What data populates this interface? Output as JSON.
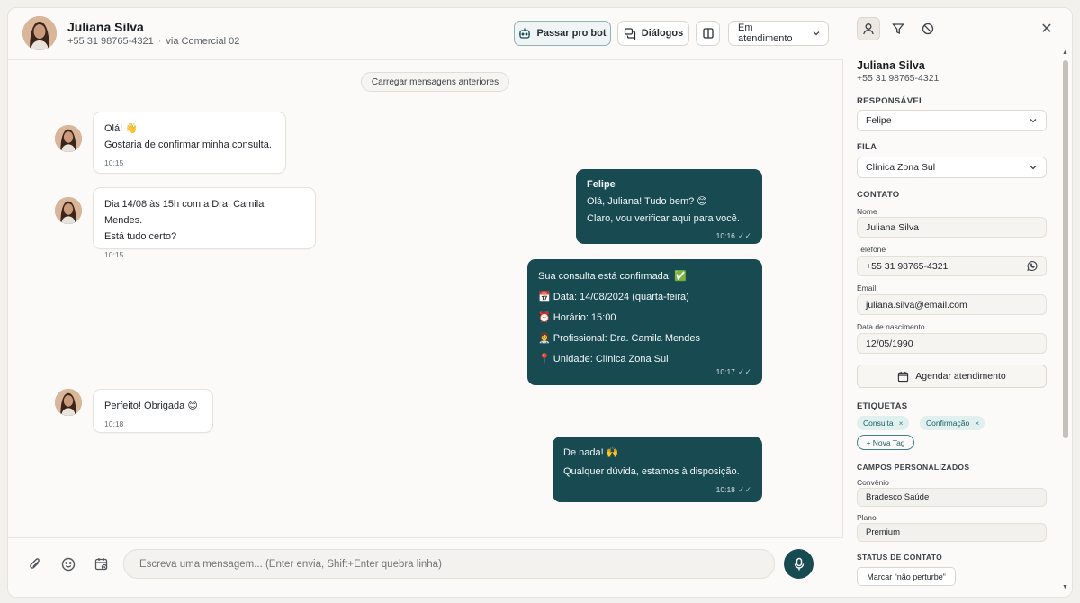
{
  "header": {
    "name": "Juliana Silva",
    "phone": "+55 31 98765-4321",
    "via": "via Comercial 02",
    "btn_bot": "Passar pro bot",
    "btn_dialogs": "Diálogos",
    "status_select": "Em atendimento"
  },
  "chat": {
    "load_more": "Carregar mensagens anteriores",
    "messages": [
      {
        "dir": "in",
        "lines": [
          "Olá! 👋",
          "Gostaria de confirmar minha consulta."
        ],
        "time": "10:15"
      },
      {
        "dir": "out",
        "sender": "Felipe",
        "lines": [
          "Olá, Juliana! Tudo bem? 😊",
          "Claro, vou verificar aqui para você."
        ],
        "time": "10:16"
      },
      {
        "dir": "in",
        "lines": [
          "Dia 14/08 às 15h com a Dra. Camila Mendes.",
          "Está tudo certo?"
        ],
        "time": "10:15"
      },
      {
        "dir": "out",
        "lines": [
          "Sua consulta está confirmada! ✅",
          "📅 Data: 14/08/2024 (quarta-feira)",
          "⏰ Horário: 15:00",
          "👩‍⚕️ Profissional: Dra. Camila Mendes",
          "📍 Unidade: Clínica Zona Sul"
        ],
        "time": "10:17"
      },
      {
        "dir": "in",
        "lines": [
          "Perfeito! Obrigada 😊"
        ],
        "time": "10:18"
      },
      {
        "dir": "out",
        "lines": [
          "De nada! 🙌",
          "Qualquer dúvida, estamos à disposição."
        ],
        "time": "10:18"
      }
    ]
  },
  "composer": {
    "placeholder": "Escreva uma mensagem... (Enter envia, Shift+Enter quebra linha)"
  },
  "sidepanel": {
    "name": "Juliana Silva",
    "phone": "+55 31 98765-4321",
    "responsavel_title": "RESPONSÁVEL",
    "responsavel_value": "Felipe",
    "fila_title": "FILA",
    "fila_value": "Clínica Zona Sul",
    "contato_title": "CONTATO",
    "nome_label": "Nome",
    "nome_value": "Juliana Silva",
    "telefone_label": "Telefone",
    "telefone_value": "+55 31 98765-4321",
    "email_label": "Email",
    "email_value": "juliana.silva@email.com",
    "nascimento_label": "Data de nascimento",
    "nascimento_value": "12/05/1990",
    "agendar_label": "Agendar atendimento",
    "etiquetas_title": "ETIQUETAS",
    "tags": [
      "Consulta",
      "Confirmação"
    ],
    "new_tag": "+ Nova Tag",
    "campos_title": "CAMPOS PERSONALIZADOS",
    "convenio_label": "Convênio",
    "convenio_value": "Bradesco Saúde",
    "plano_label": "Plano",
    "plano_value": "Premium",
    "status_title": "STATUS DE CONTATO",
    "dnd_label": "Marcar “não perturbe”"
  },
  "colors": {
    "accent": "#184a52",
    "tag_bg": "#dff0ee"
  }
}
